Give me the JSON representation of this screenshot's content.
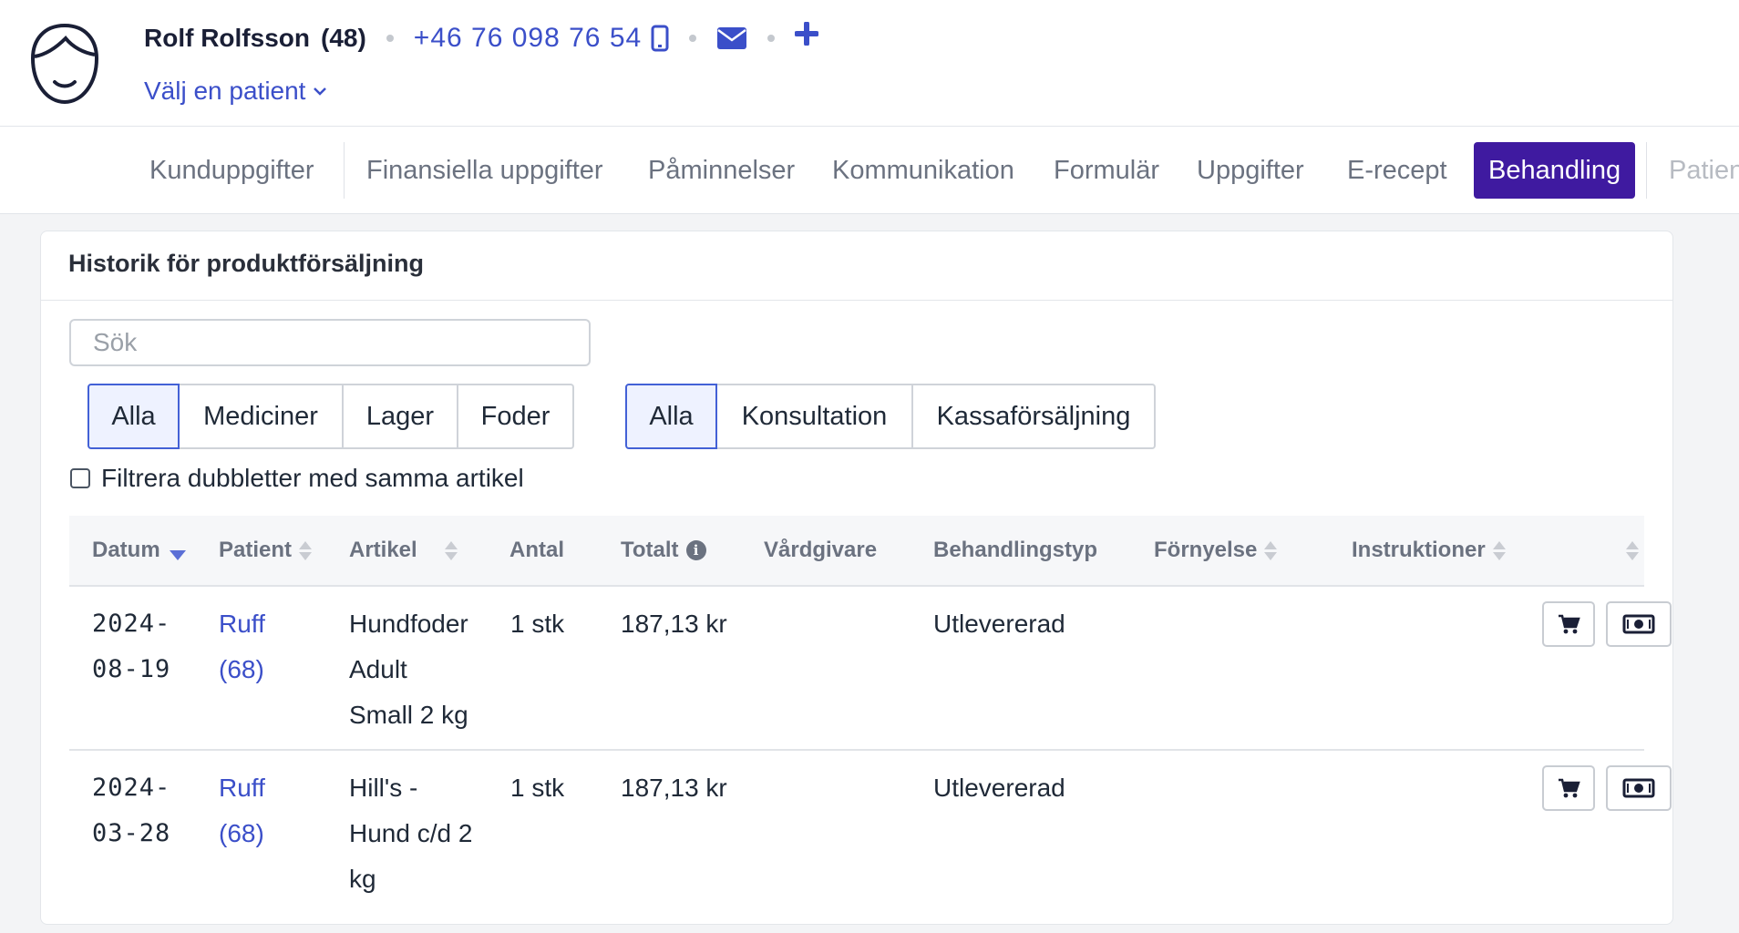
{
  "patient": {
    "name": "Rolf Rolfsson",
    "age": "(48)",
    "phone": "+46 76 098 76 54",
    "select_label": "Välj en patient"
  },
  "icons": {
    "avatar": "user-avatar-icon",
    "phone": "mobile-phone-icon",
    "email": "envelope-icon",
    "add": "plus-icon",
    "chevron": "chevron-down-icon",
    "cart": "cart-icon",
    "cash": "banknote-icon",
    "info": "info-icon"
  },
  "colors": {
    "accent": "#3b4fc9",
    "active_tab": "#3f1aa0"
  },
  "tabs": [
    "Kunduppgifter",
    "Finansiella uppgifter",
    "Påminnelser",
    "Kommunikation",
    "Formulär",
    "Uppgifter",
    "E-recept",
    "Behandling",
    "Patien"
  ],
  "active_tab": "Behandling",
  "card": {
    "title": "Historik för produktförsäljning",
    "search_placeholder": "Sök",
    "filter_group_1": [
      "Alla",
      "Mediciner",
      "Lager",
      "Foder"
    ],
    "filter_group_2": [
      "Alla",
      "Konsultation",
      "Kassaförsäljning"
    ],
    "active_filter_1": "Alla",
    "active_filter_2": "Alla",
    "duplicate_filter_label": "Filtrera dubbletter med samma artikel",
    "duplicate_filter_checked": false
  },
  "table": {
    "columns": [
      "Datum",
      "Patient",
      "Artikel",
      "Antal",
      "Totalt",
      "Vårdgivare",
      "Behandlingstyp",
      "Förnyelse",
      "Instruktioner"
    ],
    "rows": [
      {
        "date_l1": "2024-",
        "date_l2": "08-19",
        "patient_l1": "Ruff",
        "patient_l2": "(68)",
        "article_l1": "Hundfoder",
        "article_l2": "Adult",
        "article_l3": "Small 2 kg",
        "quantity": "1 stk",
        "total": "187,13 kr",
        "provider": "",
        "type": "Utlevererad"
      },
      {
        "date_l1": "2024-",
        "date_l2": "03-28",
        "patient_l1": "Ruff",
        "patient_l2": "(68)",
        "article_l1": "Hill's -",
        "article_l2": "Hund c/d 2",
        "article_l3": "kg",
        "quantity": "1 stk",
        "total": "187,13 kr",
        "provider": "",
        "type": "Utlevererad"
      }
    ]
  }
}
